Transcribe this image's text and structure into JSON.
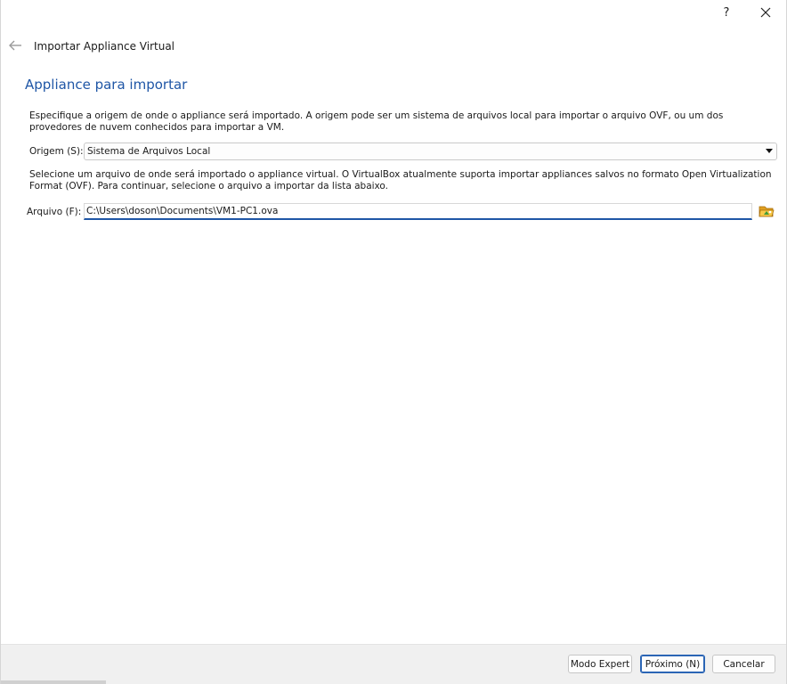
{
  "titlebar": {
    "help_label": "?",
    "close_label": "✕"
  },
  "wizard": {
    "title": "Importar Appliance Virtual",
    "heading": "Appliance para importar",
    "description_source": "Especifique a origem de onde o appliance será importado. A origem pode ser um sistema de arquivos local para importar o arquivo OVF, ou um dos provedores de nuvem conhecidos para importar a VM.",
    "description_file": "Selecione um arquivo de onde será importado o appliance virtual. O VirtualBox atualmente suporta importar appliances salvos no formato Open Virtualization Format (OVF). Para continuar, selecione o arquivo a importar da lista abaixo."
  },
  "source": {
    "label": "Origem (S):",
    "selected": "Sistema de Arquivos Local"
  },
  "file": {
    "label": "Arquivo (F):",
    "value": "C:\\Users\\doson\\Documents\\VM1-PC1.ova"
  },
  "buttons": {
    "expert": "Modo Expert",
    "next": "Próximo (N)",
    "cancel": "Cancelar"
  },
  "icons": {
    "back": "back-arrow-icon",
    "folder": "folder-open-icon",
    "dropdown": "chevron-down-icon"
  },
  "colors": {
    "heading": "#1f56a6",
    "focus_underline": "#1f56a6",
    "footer_bg": "#f0f0f0"
  }
}
